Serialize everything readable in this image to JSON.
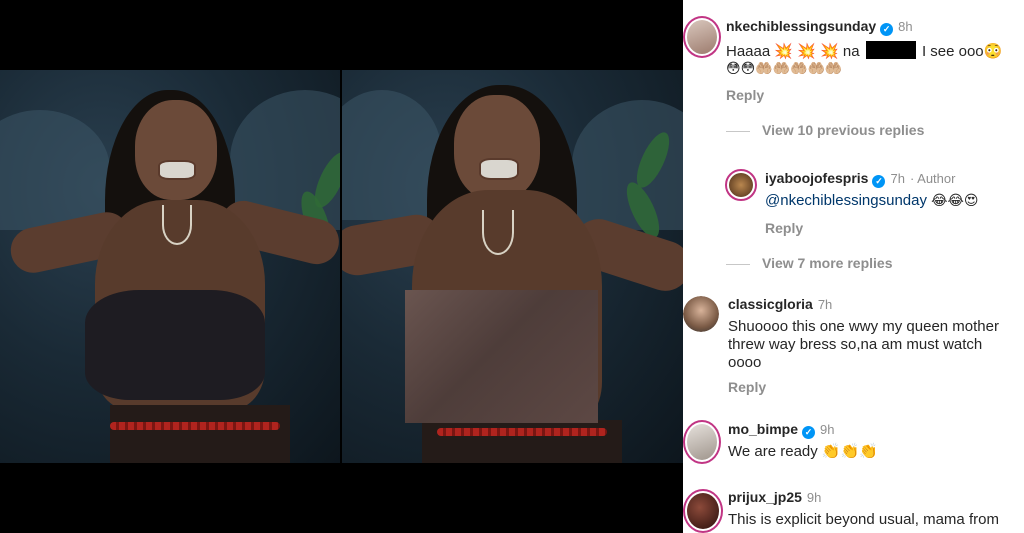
{
  "comments": [
    {
      "username": "nkechiblessingsunday",
      "time": "8h",
      "text_start": "Haaaa 💥 💥 💥 na",
      "text_end": "I see ooo😳",
      "text_line2": "😳😳🤲🏼🤲🏼🤲🏼🤲🏼🤲🏼",
      "reply_label": "Reply",
      "view_replies": "View 10 previous replies"
    },
    {
      "username": "iyaboojofespris",
      "time": "7h",
      "author_tag": "· Author",
      "mention": "@nkechiblessingsunday",
      "emojis": "😂😂😍",
      "reply_label": "Reply",
      "view_replies": "View 7 more replies"
    },
    {
      "username": "classicgloria",
      "time": "7h",
      "text_lines": [
        "Shuoooo this one wwy my queen mother",
        "threw way bress so,na  am must watch",
        "oooo"
      ],
      "reply_label": "Reply"
    },
    {
      "username": "mo_bimpe",
      "time": "9h",
      "text": "We are ready 👏👏👏"
    },
    {
      "username": "prijux_jp25",
      "time": "9h",
      "text": "This is explicit beyond usual, mama from"
    }
  ],
  "verified_icon": "verified-badge-icon",
  "colors": {
    "verified": "#0095f6",
    "mention": "#00376b",
    "story_ring": "#c13584",
    "muted": "#8e8e8e"
  }
}
